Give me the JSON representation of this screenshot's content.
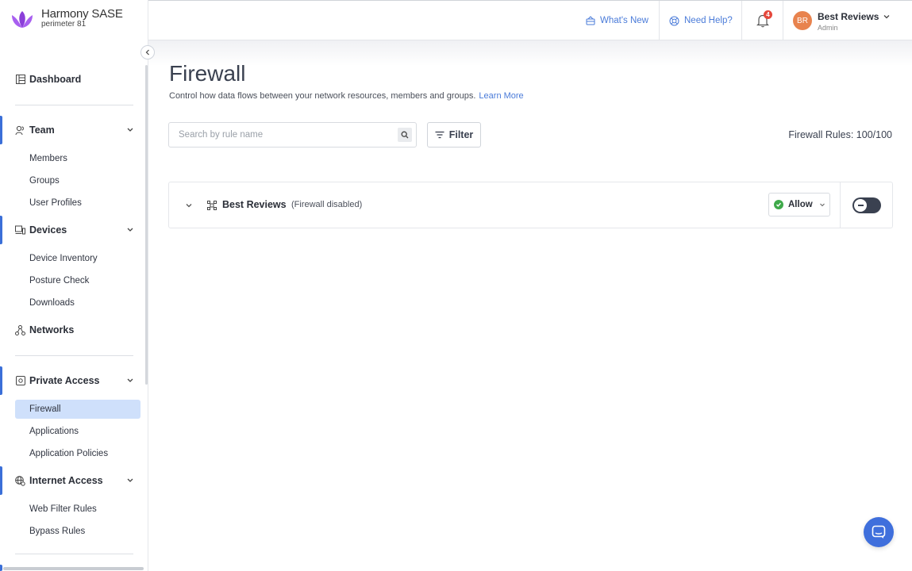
{
  "brand": {
    "title": "Harmony SASE",
    "subtitle": "perimeter 81",
    "logo_color": "#8b3fd9"
  },
  "sidebar": {
    "dashboard": "Dashboard",
    "team": {
      "label": "Team",
      "items": [
        "Members",
        "Groups",
        "User Profiles"
      ]
    },
    "devices": {
      "label": "Devices",
      "items": [
        "Device Inventory",
        "Posture Check",
        "Downloads"
      ]
    },
    "networks": "Networks",
    "private_access": {
      "label": "Private Access",
      "items": [
        "Firewall",
        "Applications",
        "Application Policies"
      ],
      "selected": "Firewall"
    },
    "internet_access": {
      "label": "Internet Access",
      "items": [
        "Web Filter Rules",
        "Bypass Rules"
      ]
    }
  },
  "header": {
    "whats_new": "What's New",
    "need_help": "Need Help?",
    "notification_count": "4",
    "user": {
      "initials": "BR",
      "name": "Best Reviews",
      "role": "Admin"
    }
  },
  "main": {
    "title": "Firewall",
    "description": "Control how data flows between your network resources, members and groups.",
    "learn_more": "Learn More",
    "search_placeholder": "Search by rule name",
    "filter_label": "Filter",
    "rule_count": "Firewall Rules: 100/100",
    "rule": {
      "name": "Best Reviews",
      "status": "(Firewall disabled)",
      "action": "Allow",
      "enabled": false
    }
  },
  "colors": {
    "accent": "#3b6fd8",
    "link": "#4a7bd9",
    "allow": "#3fa94a",
    "badge": "#e5483c",
    "avatar": "#e8834e"
  }
}
